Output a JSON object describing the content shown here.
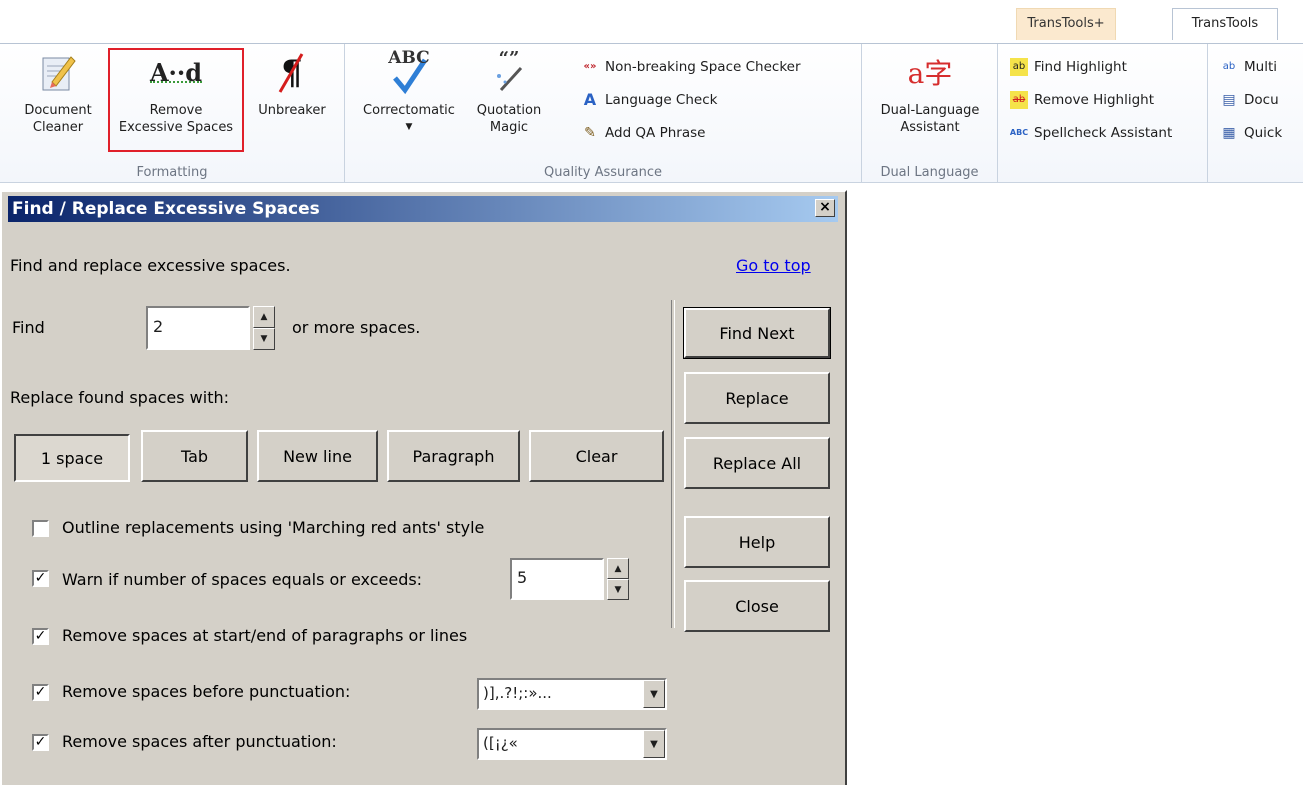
{
  "ribbon": {
    "tabs": [
      "TransTools+",
      "TransTools"
    ],
    "groups": {
      "formatting": {
        "label": "Formatting",
        "buttons": [
          {
            "label1": "Document",
            "label2": "Cleaner",
            "icon": "document-cleaner-icon"
          },
          {
            "label1": "Remove",
            "label2": "Excessive Spaces",
            "icon": "remove-excessive-spaces-icon",
            "icon_text": "A··d"
          },
          {
            "label1": "Unbreaker",
            "label2": "",
            "icon": "unbreaker-icon",
            "icon_text": "¶"
          }
        ]
      },
      "quality": {
        "label": "Quality Assurance",
        "correctomatic": {
          "label": "Correctomatic",
          "icon_text": "ABC"
        },
        "quotation": {
          "label1": "Quotation",
          "label2": "Magic",
          "icon_text": "“”"
        },
        "small": [
          {
            "label": "Non-breaking Space Checker",
            "icon_text": "«»"
          },
          {
            "label": "Language Check",
            "icon_text": "A"
          },
          {
            "label": "Add QA Phrase",
            "icon_text": "✎"
          }
        ]
      },
      "dual": {
        "label": "Dual Language",
        "button": {
          "label1": "Dual-Language",
          "label2": "Assistant",
          "icon_text": "a字"
        }
      },
      "highlight": {
        "small": [
          {
            "label": "Find Highlight",
            "icon_text": "ab"
          },
          {
            "label": "Remove Highlight",
            "icon_text": "ab"
          },
          {
            "label": "Spellcheck Assistant",
            "icon_text": "ABC"
          }
        ]
      },
      "extra": {
        "small": [
          {
            "label": "Multi",
            "icon_text": "ab"
          },
          {
            "label": "Docu",
            "icon_text": "▤"
          },
          {
            "label": "Quick",
            "icon_text": "▦"
          }
        ]
      }
    }
  },
  "dialog": {
    "title": "Find / Replace Excessive Spaces",
    "close": "×",
    "intro": "Find and replace excessive spaces.",
    "goto_top": "Go to top",
    "find_label": "Find",
    "find_value": "2",
    "find_suffix": "or more spaces.",
    "replace_with_label": "Replace found spaces with:",
    "replace_options": [
      "1 space",
      "Tab",
      "New line",
      "Paragraph",
      "Clear"
    ],
    "selected_option": "1 space",
    "options": [
      {
        "label": "Outline replacements using 'Marching red ants' style",
        "checked": false
      },
      {
        "label": "Warn if number of spaces equals or exceeds:",
        "checked": true,
        "value": "5"
      },
      {
        "label": "Remove spaces at start/end of paragraphs or lines",
        "checked": true
      },
      {
        "label": "Remove spaces before punctuation:",
        "checked": true,
        "value": ")],.?!;:»..."
      },
      {
        "label": "Remove spaces after punctuation:",
        "checked": true,
        "value": "([¡¿«"
      }
    ],
    "actions": [
      "Find Next",
      "Replace",
      "Replace All",
      "Help",
      "Close"
    ]
  }
}
